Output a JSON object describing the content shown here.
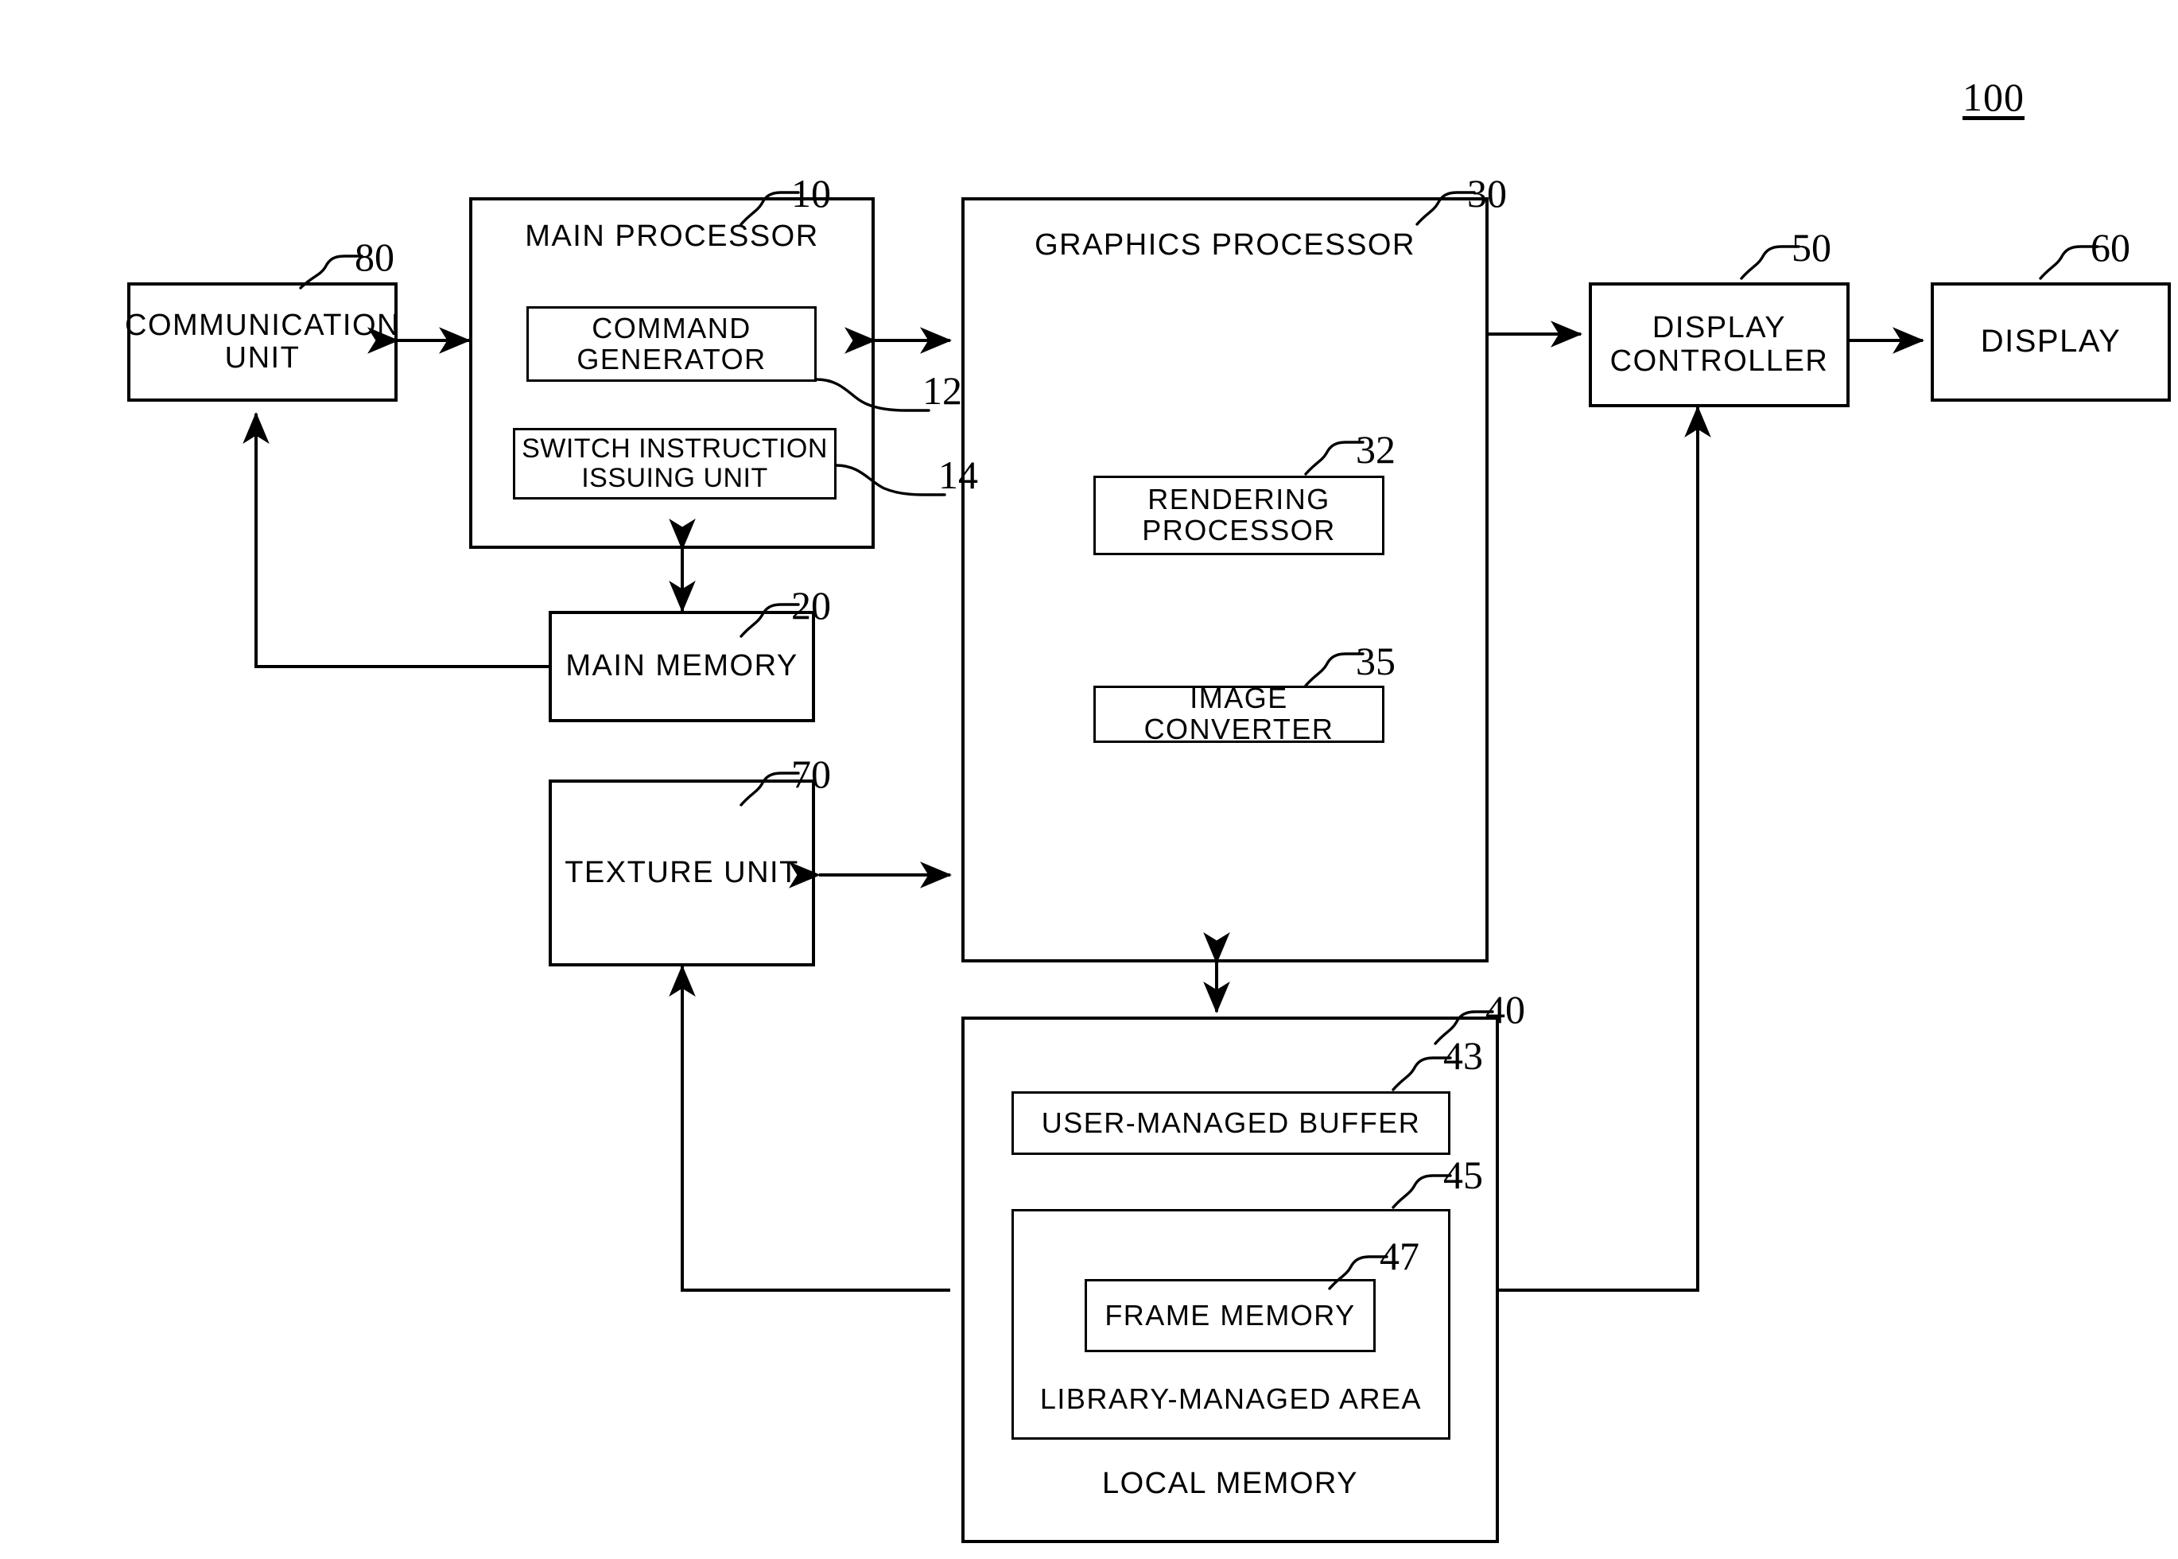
{
  "figure": {
    "number": "100"
  },
  "blocks": {
    "communication_unit": {
      "label": "COMMUNICATION\nUNIT",
      "ref": "80"
    },
    "main_processor": {
      "label": "MAIN PROCESSOR",
      "ref": "10"
    },
    "command_generator": {
      "label": "COMMAND\nGENERATOR",
      "ref": "12"
    },
    "switch_instruction_issuing_unit": {
      "label": "SWITCH INSTRUCTION\nISSUING UNIT",
      "ref": "14"
    },
    "main_memory": {
      "label": "MAIN MEMORY",
      "ref": "20"
    },
    "texture_unit": {
      "label": "TEXTURE UNIT",
      "ref": "70"
    },
    "graphics_processor": {
      "label": "GRAPHICS PROCESSOR",
      "ref": "30"
    },
    "rendering_processor": {
      "label": "RENDERING\nPROCESSOR",
      "ref": "32"
    },
    "image_converter": {
      "label": "IMAGE CONVERTER",
      "ref": "35"
    },
    "display_controller": {
      "label": "DISPLAY\nCONTROLLER",
      "ref": "50"
    },
    "display": {
      "label": "DISPLAY",
      "ref": "60"
    },
    "local_memory": {
      "label": "LOCAL MEMORY",
      "ref": "40"
    },
    "user_managed_buffer": {
      "label": "USER-MANAGED BUFFER",
      "ref": "43"
    },
    "library_managed_area": {
      "label": "LIBRARY-MANAGED AREA",
      "ref": "45"
    },
    "frame_memory": {
      "label": "FRAME MEMORY",
      "ref": "47"
    }
  }
}
